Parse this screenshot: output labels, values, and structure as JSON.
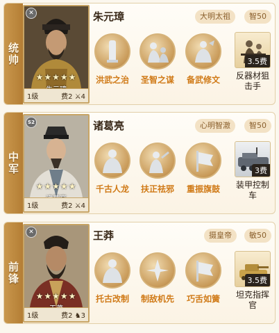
{
  "cards": [
    {
      "position": "统帅",
      "hero_name": "朱元璋",
      "portrait_badge": "",
      "stars": "★★★★★",
      "portrait_name": "朱元璋",
      "level": "1级",
      "cost": "费2",
      "troop_count": "4",
      "title_tag": "大明太祖",
      "stat_tag": "智50",
      "skills": [
        "洪武之治",
        "圣智之谋",
        "备武修文"
      ],
      "tactic": {
        "label": "反器材狙击手",
        "cost": "3.5费"
      }
    },
    {
      "position": "中军",
      "hero_name": "诸葛亮",
      "portrait_badge": "S2",
      "stars": "★★★★★",
      "portrait_name": "诸葛亮",
      "level": "1级",
      "cost": "费2",
      "troop_count": "4",
      "title_tag": "心明智澈",
      "stat_tag": "智50",
      "skills": [
        "千古人龙",
        "扶正祛邪",
        "重振旗鼓"
      ],
      "tactic": {
        "label": "装甲控制车",
        "cost": "3费"
      }
    },
    {
      "position": "前锋",
      "hero_name": "王莽",
      "portrait_badge": "",
      "stars": "★★★★★",
      "portrait_name": "王莽",
      "level": "1级",
      "cost": "费2",
      "troop_count": "3",
      "title_tag": "摄皇帝",
      "stat_tag": "敏50",
      "skills": [
        "托古改制",
        "制敌机先",
        "巧舌如簧"
      ],
      "tactic": {
        "label": "坦克指挥官",
        "cost": "3.5费"
      }
    }
  ],
  "colors": {
    "position_strip": "#b47e35",
    "skill_label": "#d07a17",
    "pill_bg": "#f3e2c5",
    "pill_text": "#8a5f2c"
  }
}
